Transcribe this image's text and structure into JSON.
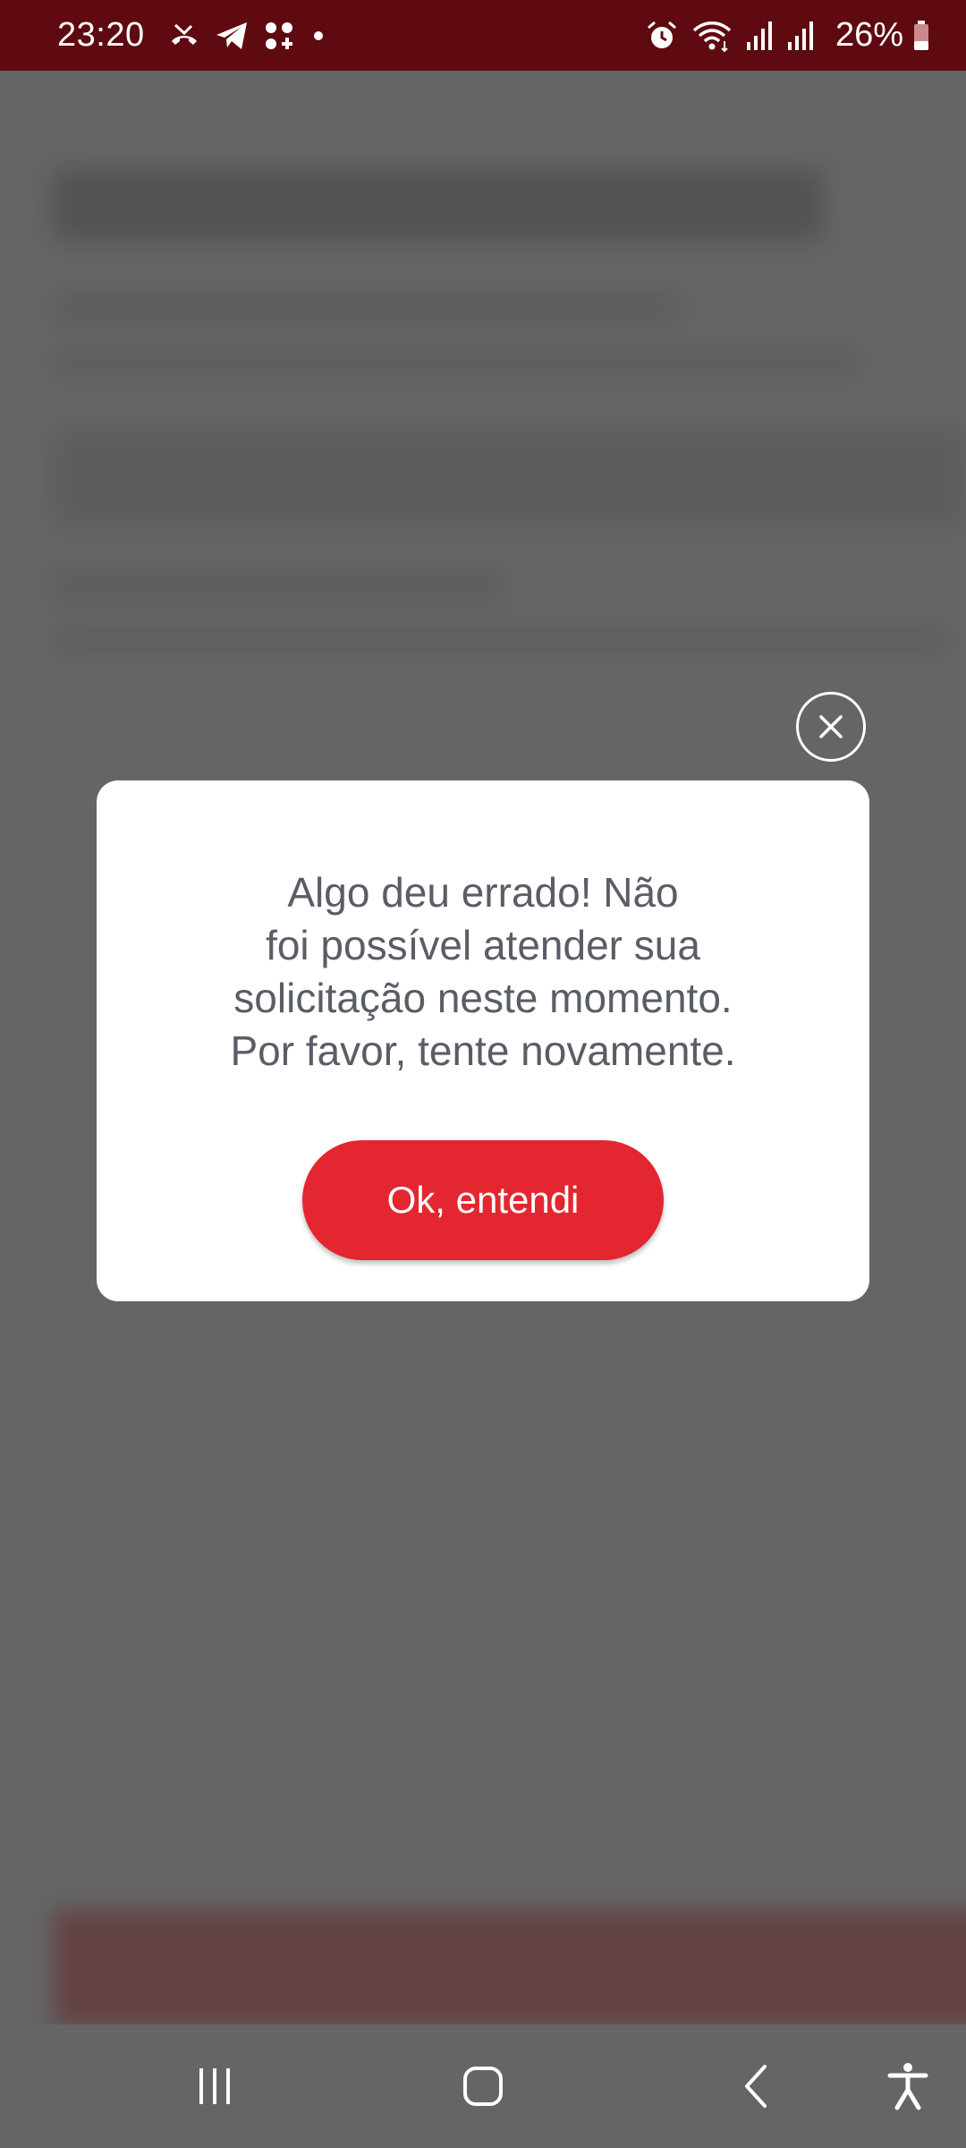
{
  "status_bar": {
    "time": "23:20",
    "battery_percent": "26%",
    "left_icons": [
      "missed-call-icon",
      "telegram-icon",
      "app-grid-icon",
      "notification-dot-icon"
    ],
    "right_icons": [
      "alarm-icon",
      "wifi-icon",
      "signal-icon",
      "signal-icon",
      "battery-icon"
    ],
    "background_color": "#5e0a10"
  },
  "dialog": {
    "message_lines": [
      "Algo deu errado! Não",
      "foi possível atender sua",
      "solicitação neste momento.",
      "Por favor, tente novamente."
    ],
    "ok_button_label": "Ok, entendi",
    "accent_color": "#e42630",
    "close_icon": "close-icon"
  },
  "nav_bar": {
    "items": [
      "recent-apps-icon",
      "home-icon",
      "back-icon",
      "accessibility-icon"
    ]
  }
}
